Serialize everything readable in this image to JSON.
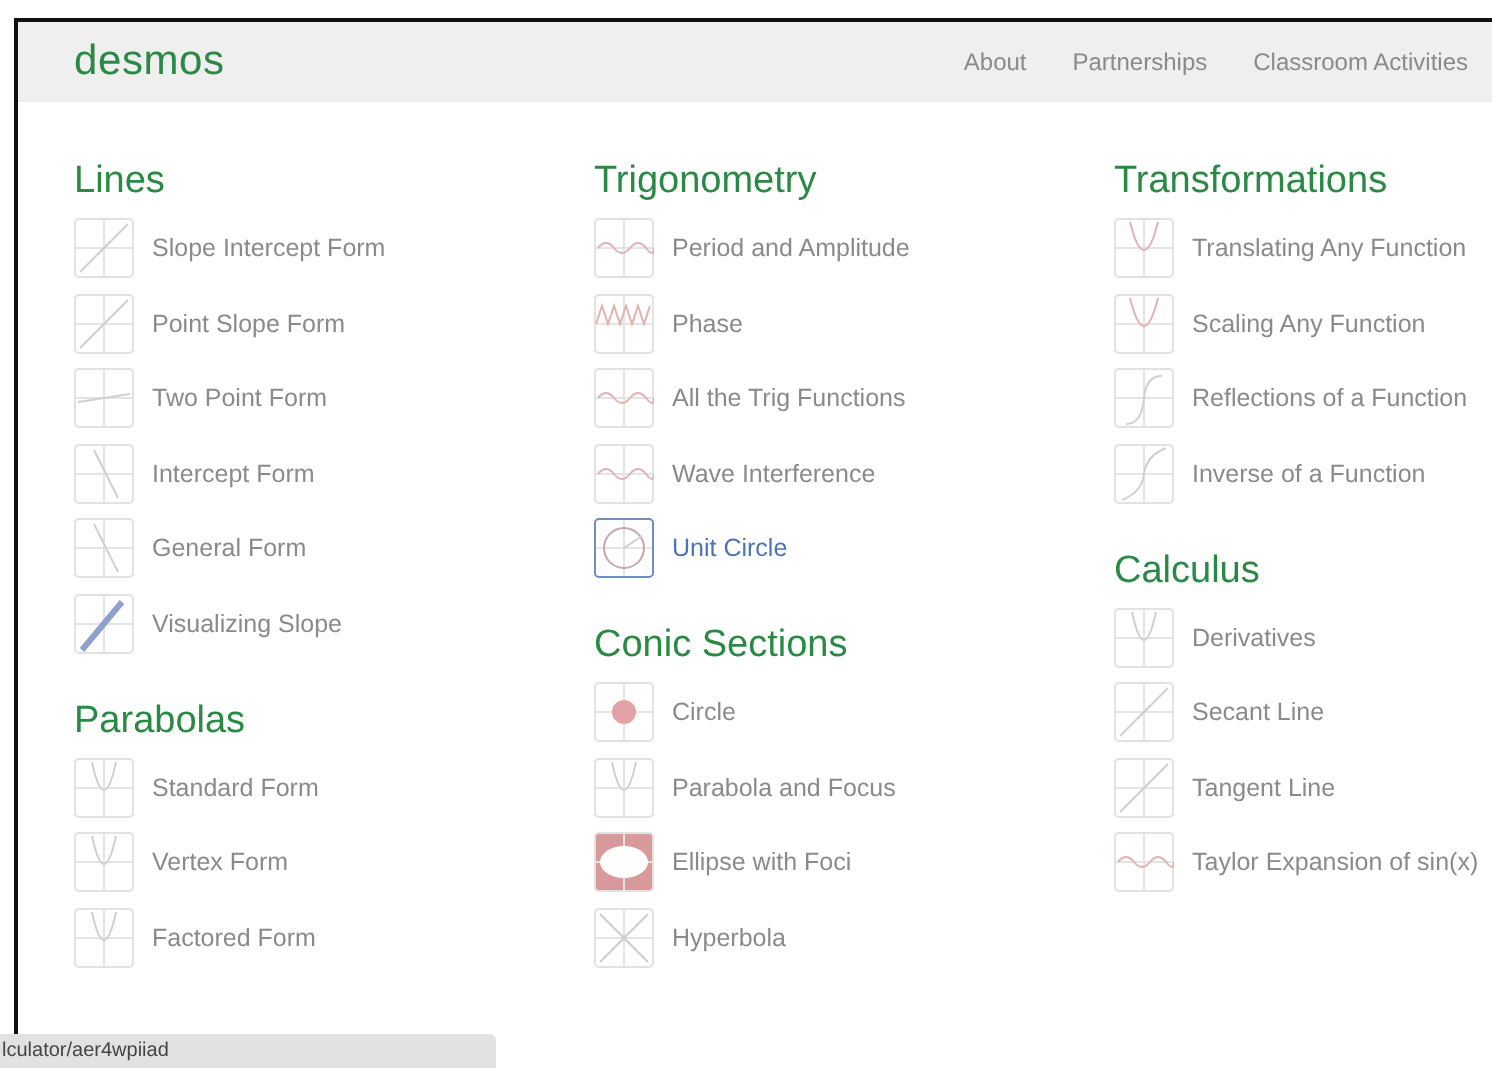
{
  "header": {
    "logo": "desmos",
    "nav": [
      "About",
      "Partnerships",
      "Classroom Activities"
    ]
  },
  "columns": [
    {
      "sections": [
        {
          "title": "Lines",
          "items": [
            {
              "label": "Slope Intercept Form",
              "selected": false
            },
            {
              "label": "Point Slope Form",
              "selected": false
            },
            {
              "label": "Two Point Form",
              "selected": false
            },
            {
              "label": "Intercept Form",
              "selected": false
            },
            {
              "label": "General Form",
              "selected": false
            },
            {
              "label": "Visualizing Slope",
              "selected": false
            }
          ]
        },
        {
          "title": "Parabolas",
          "items": [
            {
              "label": "Standard Form",
              "selected": false
            },
            {
              "label": "Vertex Form",
              "selected": false
            },
            {
              "label": "Factored Form",
              "selected": false
            }
          ]
        }
      ]
    },
    {
      "sections": [
        {
          "title": "Trigonometry",
          "items": [
            {
              "label": "Period and Amplitude",
              "selected": false
            },
            {
              "label": "Phase",
              "selected": false
            },
            {
              "label": "All the Trig Functions",
              "selected": false
            },
            {
              "label": "Wave Interference",
              "selected": false
            },
            {
              "label": "Unit Circle",
              "selected": true
            }
          ]
        },
        {
          "title": "Conic Sections",
          "items": [
            {
              "label": "Circle",
              "selected": false
            },
            {
              "label": "Parabola and Focus",
              "selected": false
            },
            {
              "label": "Ellipse with Foci",
              "selected": false
            },
            {
              "label": "Hyperbola",
              "selected": false
            }
          ]
        }
      ]
    },
    {
      "sections": [
        {
          "title": "Transformations",
          "items": [
            {
              "label": "Translating Any Function",
              "selected": false
            },
            {
              "label": "Scaling Any Function",
              "selected": false
            },
            {
              "label": "Reflections of a Function",
              "selected": false
            },
            {
              "label": "Inverse of a Function",
              "selected": false
            }
          ]
        },
        {
          "title": "Calculus",
          "items": [
            {
              "label": "Derivatives",
              "selected": false
            },
            {
              "label": "Secant Line",
              "selected": false
            },
            {
              "label": "Tangent Line",
              "selected": false
            },
            {
              "label": "Taylor Expansion of sin(x)",
              "selected": false
            }
          ]
        }
      ]
    }
  ],
  "status_bar": {
    "url": "lculator/aer4wpiiad"
  }
}
